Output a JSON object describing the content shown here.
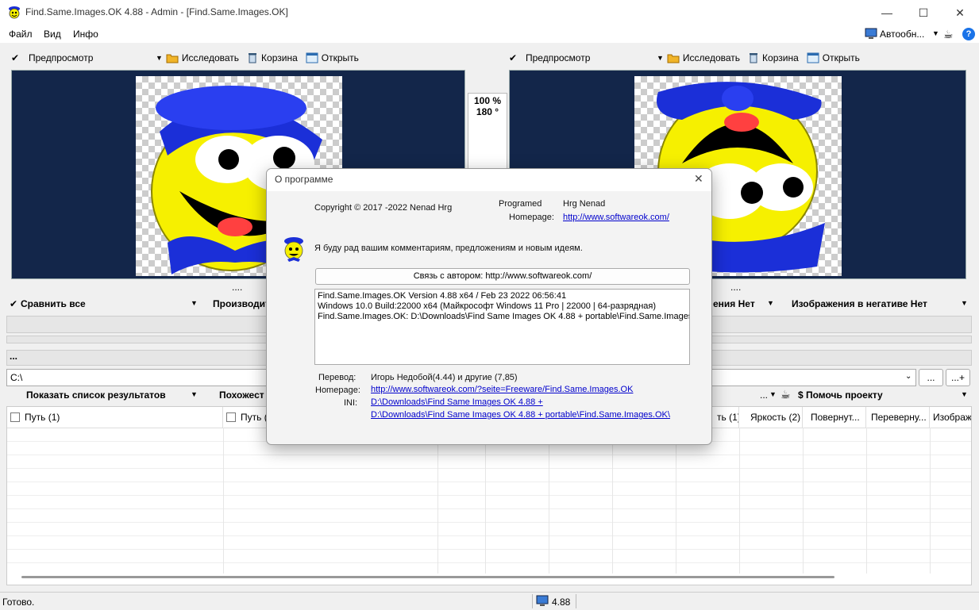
{
  "window": {
    "title": "Find.Same.Images.OK 4.88 - Admin - [Find.Same.Images.OK]",
    "minimize": "—",
    "maximize": "☐",
    "close": "✕"
  },
  "menu": {
    "items": [
      "Файл",
      "Вид",
      "Инфо"
    ],
    "autoscan": "Автообн...",
    "help": "?"
  },
  "left_toolbar": {
    "preview": "Предпросмотр",
    "explore": "Исследовать",
    "trash": "Корзина",
    "open": "Открыть"
  },
  "right_toolbar": {
    "preview": "Предпросмотр",
    "explore": "Исследовать",
    "trash": "Корзина",
    "open": "Открыть"
  },
  "zoom": {
    "percent": "100 %",
    "rotation": "180 °"
  },
  "dots": "....",
  "options": {
    "compare_all": "Сравнить все",
    "performance": "Производит",
    "negative_partial": "ения Нет",
    "negative": "Изображения в негативе Нет"
  },
  "progress_label": "...",
  "path": {
    "value": "C:\\",
    "browse": "...",
    "add": "...+"
  },
  "results_bar": {
    "show_list": "Показать список результатов",
    "similar": "Похожест",
    "more": "...",
    "support": "$ Помочь проекту"
  },
  "columns": [
    "Путь (1)",
    "Путь (",
    "ть (1)",
    "Яркость (2)",
    "Повернут...",
    "Переверну...",
    "Изображе"
  ],
  "status": {
    "ready": "Готово.",
    "version": "4.88"
  },
  "dialog": {
    "title": "О программе",
    "copyright": "Copyright © 2017 -2022 Nenad Hrg",
    "programmed_label": "Programed",
    "programmed_value": "Hrg Nenad",
    "homepage_label": "Homepage:",
    "homepage_url": "http://www.softwareok.com/",
    "message": "Я буду рад вашим комментариям, предложениям и новым идеям.",
    "contact_button": "Связь с автором: http://www.softwareok.com/",
    "info_lines": [
      "Find.Same.Images.OK Version 4.88  x64  /  Feb 23 2022 06:56:41",
      "Windows 10.0 Build:22000 x64 (Майкрософт Windows 11 Pro | 22000 | 64-разрядная)",
      "Find.Same.Images.OK: D:\\Downloads\\Find Same Images OK 4.88 + portable\\Find.Same.Images."
    ],
    "translation_label": "Перевод:",
    "translation_value": "Игорь Недобой(4.44) и другие  (7,85)",
    "homepage2_label": "Homepage:",
    "homepage2_url": "http://www.softwareok.com/?seite=Freeware/Find.Same.Images.OK",
    "ini_label": "INI:",
    "ini_line1": "D:\\Downloads\\Find Same Images OK 4.88 +",
    "ini_line2": "D:\\Downloads\\Find Same Images OK 4.88 + portable\\Find.Same.Images.OK\\"
  },
  "colors": {
    "preview_bg": "#13264a",
    "smiley_yellow": "#f6f000",
    "hat_blue": "#1b2fd8",
    "link": "#0000cc"
  }
}
